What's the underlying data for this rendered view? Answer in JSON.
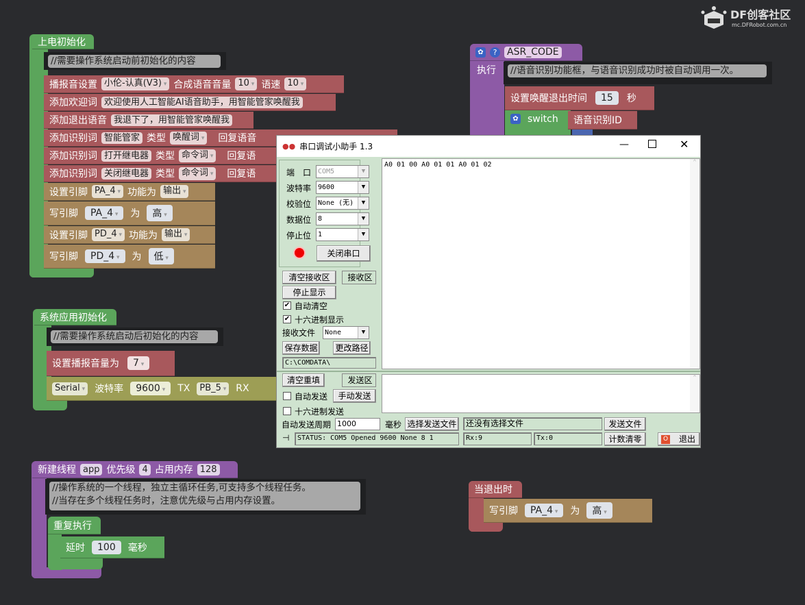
{
  "logo": {
    "brand": "DF创客社区",
    "url": "mc.DFRobot.com.cn"
  },
  "block_poweron": {
    "title": "上电初始化",
    "comment": "//需要操作系统启动前初始化的内容",
    "tts": {
      "label": "播报音设置",
      "voice": "小伦-认真(V3)",
      "vol_label": "合成语音音量",
      "vol": "10",
      "speed_label": "语速",
      "speed": "10"
    },
    "welcome": {
      "label": "添加欢迎词",
      "text": "欢迎使用人工智能AI语音助手，用智能管家唤醒我"
    },
    "exit": {
      "label": "添加退出语音",
      "text": "我退下了，用智能管家唤醒我"
    },
    "words": [
      {
        "label": "添加识别词",
        "word": "智能管家",
        "type_label": "类型",
        "type": "唤醒词",
        "reply_label": "回复语音"
      },
      {
        "label": "添加识别词",
        "word": "打开继电器",
        "type_label": "类型",
        "type": "命令词",
        "reply_label": "回复语"
      },
      {
        "label": "添加识别词",
        "word": "关闭继电器",
        "type_label": "类型",
        "type": "命令词",
        "reply_label": "回复语"
      }
    ],
    "pins": [
      {
        "label": "设置引脚",
        "pin": "PA_4",
        "mode_label": "功能为",
        "mode": "输出"
      },
      {
        "label": "写引脚",
        "pin": "PA_4",
        "is": "为",
        "val": "高"
      },
      {
        "label": "设置引脚",
        "pin": "PD_4",
        "mode_label": "功能为",
        "mode": "输出"
      },
      {
        "label": "写引脚",
        "pin": "PD_4",
        "is": "为",
        "val": "低"
      }
    ]
  },
  "block_sysinit": {
    "title": "系统应用初始化",
    "comment": "//需要操作系统启动后初始化的内容",
    "vol_label": "设置播报音量为",
    "vol": "7",
    "serial": {
      "port": "Serial",
      "baud_label": "波特率",
      "baud": "9600",
      "tx_label": "TX",
      "tx": "PB_5",
      "rx_label": "RX"
    }
  },
  "block_thread": {
    "label": "新建线程",
    "name": "app",
    "prio_label": "优先级",
    "prio": "4",
    "mem_label": "占用内存",
    "mem": "128",
    "comment1": "//操作系统的一个线程，独立主循环任务,可支持多个线程任务。",
    "comment2": "//当存在多个线程任务时，注意优先级与占用内存设置。",
    "loop": "重复执行",
    "delay_label": "延时",
    "delay": "100",
    "delay_unit": "毫秒"
  },
  "block_asr": {
    "name": "ASR_CODE",
    "exec": "执行",
    "comment": "//语音识别功能框，与语音识别成功时被自动调用一次。",
    "timeout_label": "设置唤醒退出时间",
    "timeout": "15",
    "timeout_unit": "秒",
    "switch": "switch",
    "switch_arg": "语音识别ID"
  },
  "block_exit": {
    "title": "当退出时",
    "label": "写引脚",
    "pin": "PA_4",
    "is": "为",
    "val": "高"
  },
  "dialog": {
    "title": "串口调试小助手 1.3",
    "port_label": "端　口",
    "port": "COM5",
    "baud_label": "波特率",
    "baud": "9600",
    "parity_label": "校验位",
    "parity": "None (无)",
    "data_label": "数据位",
    "data": "8",
    "stop_label": "停止位",
    "stop": "1",
    "close_port": "关闭串口",
    "clear_rx": "清空接收区",
    "rx_area": "接收区",
    "stop_display": "停止显示",
    "auto_clear": "自动清空",
    "hex_display": "十六进制显示",
    "rx_file_label": "接收文件",
    "rx_file": "None",
    "save_data": "保存数据",
    "change_path": "更改路径",
    "path": "C:\\COMDATA\\",
    "received": "A0 01 00 A0 01 01 A0 01 02",
    "clear_tx": "清空重填",
    "tx_area": "发送区",
    "auto_send": "自动发送",
    "manual_send": "手动发送",
    "hex_send": "十六进制发送",
    "period_label": "自动发送周期",
    "period": "1000",
    "period_unit": "毫秒",
    "select_file": "选择发送文件",
    "file_status": "还没有选择文件",
    "send_file": "发送文件",
    "status": "STATUS: COM5 Opened 9600 None  8 1",
    "rx": "Rx:9",
    "tx": "Tx:0",
    "reset_count": "计数清零",
    "exit": "退出"
  }
}
